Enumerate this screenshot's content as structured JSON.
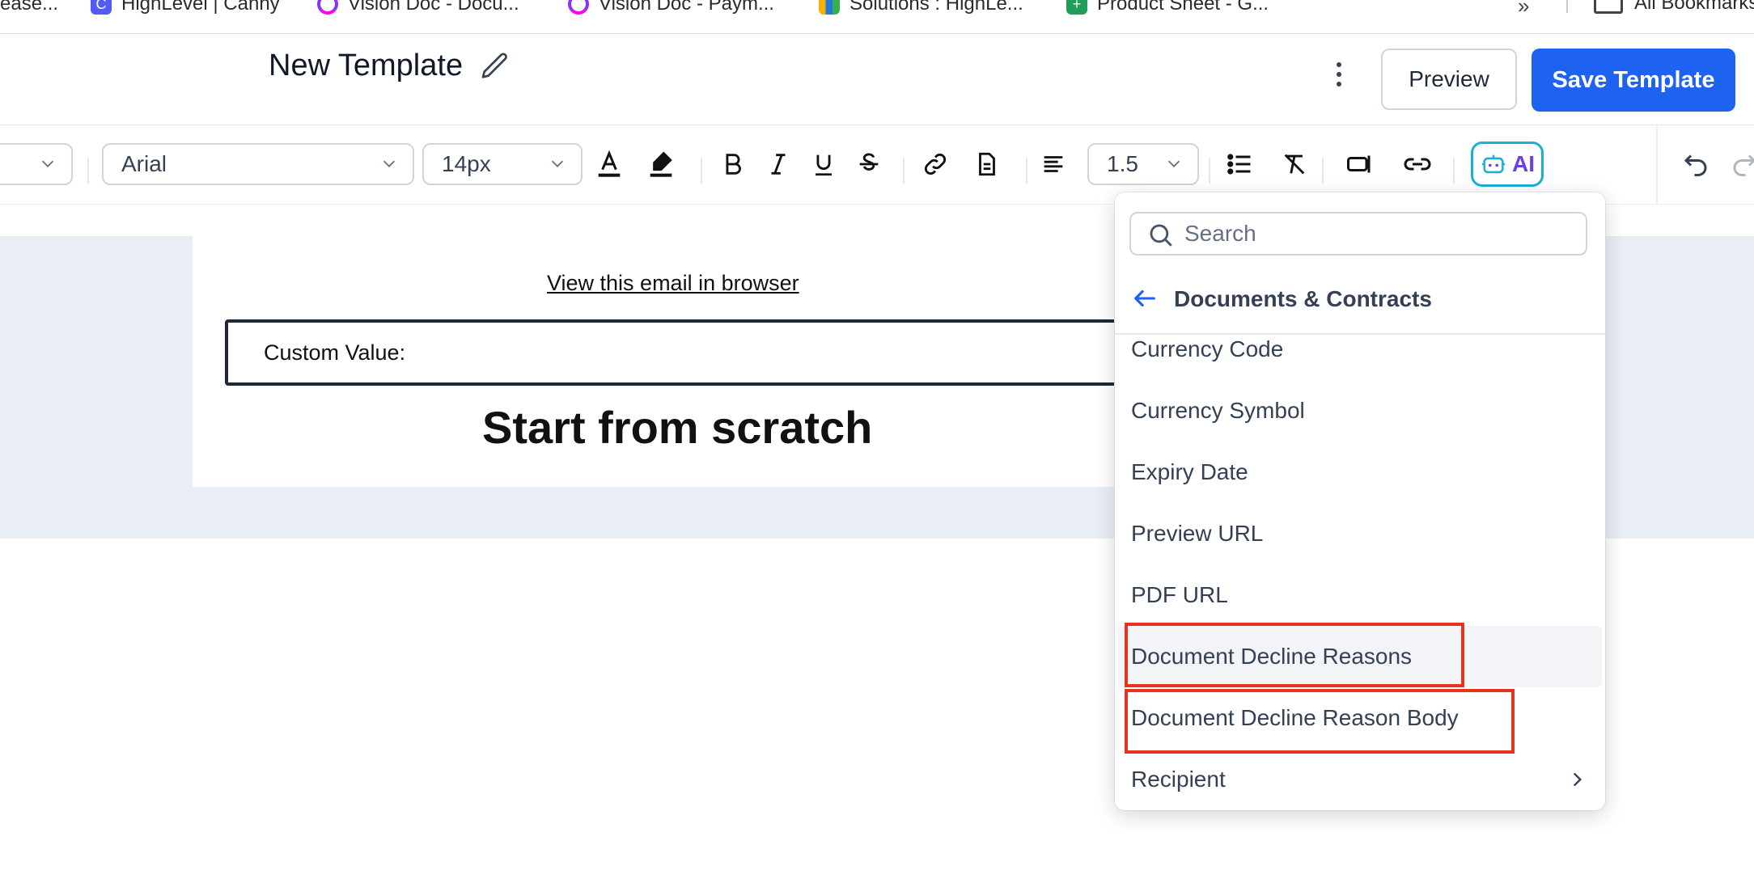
{
  "bookmarks": [
    {
      "label": "ease...",
      "icon": "doc-icon"
    },
    {
      "label": "HighLevel | Canny",
      "icon": "canny-icon"
    },
    {
      "label": "Vision Doc - Docu...",
      "icon": "clickup-icon"
    },
    {
      "label": "Vision Doc - Paym...",
      "icon": "clickup-icon"
    },
    {
      "label": "Solutions : HighLe...",
      "icon": "highlevel-icon"
    },
    {
      "label": "Product Sheet - G...",
      "icon": "sheets-icon"
    }
  ],
  "bookmarks_more": "»",
  "bookmarks_all": "All Bookmarks",
  "header": {
    "title": "New Template",
    "preview_label": "Preview",
    "save_label": "Save Template"
  },
  "toolbar": {
    "font_family": "Arial",
    "font_size": "14px",
    "line_height": "1.5",
    "ai_label": "AI"
  },
  "email": {
    "view_link": "View this email in browser",
    "custom_value_label": "Custom Value:",
    "heading": "Start from scratch"
  },
  "dropdown": {
    "search_placeholder": "Search",
    "section_title": "Documents & Contracts",
    "items": [
      "Currency Code",
      "Currency Symbol",
      "Expiry Date",
      "Preview URL",
      "PDF URL",
      "Document Decline Reasons",
      "Document Decline Reason Body",
      "Recipient"
    ]
  },
  "colors": {
    "primary": "#1d62f0",
    "highlight_border": "#e53320",
    "canvas_bg": "#e9edf5",
    "ai_border": "#1bb0d6",
    "ai_text": "#6940e6"
  }
}
